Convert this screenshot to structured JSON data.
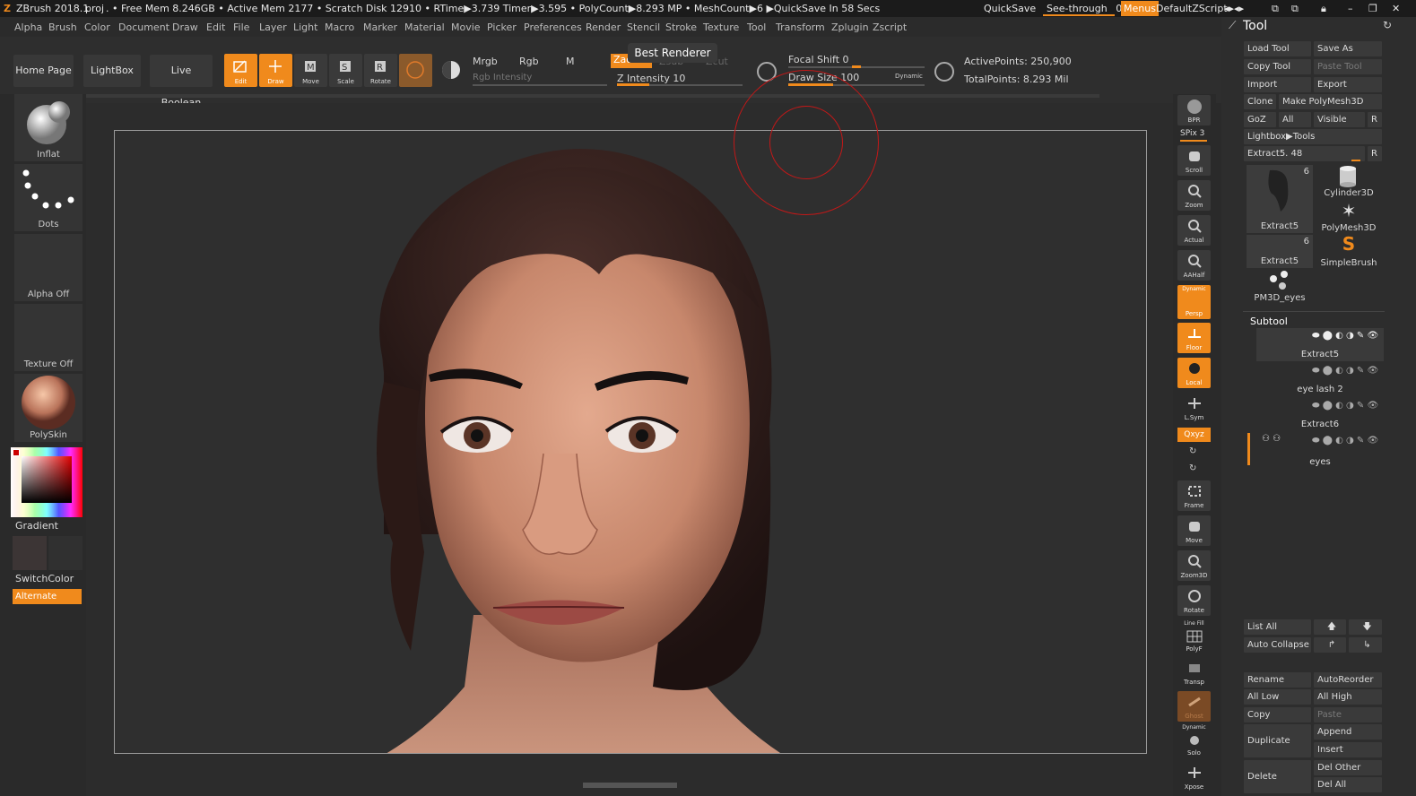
{
  "titlebar": {
    "app": "ZBrush 2018.1",
    "project": "proj",
    "stats": ". • Free Mem 8.246GB • Active Mem 2177 • Scratch Disk 12910 • RTime▶3.739 Timer▶3.595 • PolyCount▶8.293 MP • MeshCount▶6 ▶QuickSave In 58 Secs",
    "quicksave": "QuickSave",
    "see_through": "See-through",
    "see_through_value": "0",
    "menus": "Menus",
    "script": "DefaultZScript"
  },
  "menubar": [
    "Alpha",
    "Brush",
    "Color",
    "Document",
    "Draw",
    "Edit",
    "File",
    "Layer",
    "Light",
    "Macro",
    "Marker",
    "Material",
    "Movie",
    "Picker",
    "Preferences",
    "Render",
    "Stencil",
    "Stroke",
    "Texture",
    "Tool",
    "Transform",
    "Zplugin",
    "Zscript"
  ],
  "shelf": {
    "home_page": "Home Page",
    "lightbox": "LightBox",
    "live_boolean": "Live Boolean",
    "edit": "Edit",
    "draw": "Draw",
    "move": "Move",
    "scale": "Scale",
    "rotate": "Rotate",
    "mrgb": "Mrgb",
    "rgb": "Rgb",
    "m": "M",
    "rgb_intensity": "Rgb Intensity",
    "zadd": "Zadd",
    "zsub": "Zsub",
    "zcut": "Zcut",
    "z_intensity": "Z Intensity 10",
    "z_intensity_level": 0.26,
    "tooltip": "Best Renderer",
    "focal_shift": "Focal Shift 0",
    "focal_shift_level": 0.5,
    "draw_size": "Draw Size 100",
    "draw_size_level": 0.33,
    "dynamic": "Dynamic",
    "active_points": "ActivePoints: 250,900",
    "total_points": "TotalPoints: 8.293 Mil"
  },
  "left": {
    "brush": "Inflat",
    "stroke": "Dots",
    "alpha": "Alpha Off",
    "texture": "Texture Off",
    "material": "PolySkin",
    "gradient": "Gradient",
    "switch_color": "SwitchColor",
    "alternate": "Alternate"
  },
  "right_shelf": {
    "bpr": "BPR",
    "spix": "SPix 3",
    "scroll": "Scroll",
    "zoom": "Zoom",
    "actual": "Actual",
    "aahalf": "AAHalf",
    "persp_top": "Dynamic",
    "persp": "Persp",
    "floor": "Floor",
    "local": "Local",
    "lsym": "L.Sym",
    "xyz": "Qxyz",
    "frame": "Frame",
    "move": "Move",
    "zoom3d": "Zoom3D",
    "rotate": "Rotate",
    "linefill_top": "Line Fill",
    "polyf": "PolyF",
    "transp": "Transp",
    "ghost": "Ghost",
    "solo_top": "Dynamic",
    "solo": "Solo",
    "xpose": "Xpose"
  },
  "tool": {
    "title": "Tool",
    "load_tool": "Load Tool",
    "save_as": "Save As",
    "copy_tool": "Copy Tool",
    "paste_tool": "Paste Tool",
    "import": "Import",
    "export": "Export",
    "clone": "Clone",
    "make_polymesh": "Make PolyMesh3D",
    "goz": "GoZ",
    "all": "All",
    "visible": "Visible",
    "r": "R",
    "lightbox_tools": "Lightbox▶Tools",
    "extract_slider": "Extract5. 48",
    "thumbs": [
      {
        "label": "Extract5",
        "count": "6"
      },
      {
        "label": "Cylinder3D"
      },
      {
        "label": "PolyMesh3D"
      },
      {
        "label": "Extract5",
        "count": "6"
      },
      {
        "label": "SimpleBrush"
      },
      {
        "label": "PM3D_eyes"
      }
    ],
    "subtool_title": "Subtool",
    "subtools": [
      "Extract5",
      "eye lash 2",
      "Extract6",
      "eyes"
    ],
    "list_all": "List All",
    "auto_collapse": "Auto Collapse",
    "rename": "Rename",
    "auto_reorder": "AutoReorder",
    "all_low": "All Low",
    "all_high": "All High",
    "copy": "Copy",
    "paste": "Paste",
    "duplicate": "Duplicate",
    "append": "Append",
    "insert": "Insert",
    "delete": "Delete",
    "del_other": "Del Other",
    "del_all": "Del All"
  }
}
